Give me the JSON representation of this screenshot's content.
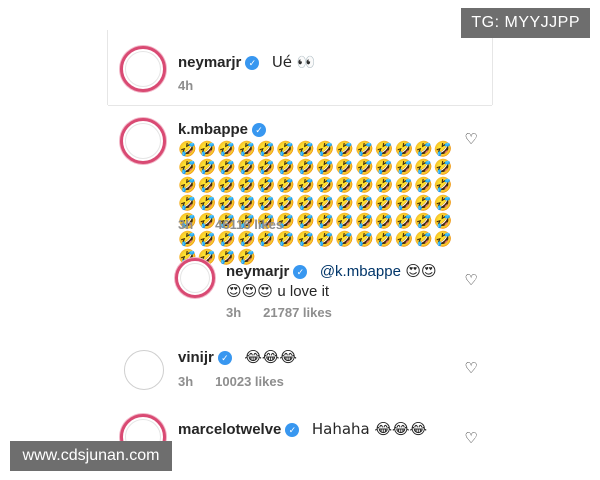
{
  "badge": {
    "text": "TG: MYYJJPP"
  },
  "watermark": {
    "text": "www.cdsjunan.com"
  },
  "verified_glyph": "✓",
  "heart_glyph": "♡",
  "comments": [
    {
      "user": "neymarjr",
      "text": "Ué 👀",
      "time": "4h"
    },
    {
      "user": "k.mbappe",
      "text": "🤣🤣🤣🤣🤣🤣🤣🤣🤣🤣🤣🤣🤣🤣🤣🤣🤣🤣🤣🤣🤣🤣🤣🤣🤣🤣🤣🤣🤣🤣🤣🤣🤣🤣🤣🤣🤣🤣🤣🤣🤣🤣🤣🤣🤣🤣🤣🤣🤣🤣🤣🤣🤣🤣🤣🤣🤣🤣🤣🤣🤣🤣🤣🤣🤣🤣🤣🤣🤣🤣🤣🤣🤣🤣🤣🤣🤣🤣🤣🤣🤣🤣🤣🤣🤣🤣🤣🤣",
      "time": "3h",
      "likes": "46116 likes"
    },
    {
      "user": "neymarjr",
      "mention": "@k.mbappe",
      "emoji1": "😍😍",
      "emoji2": "😍😍😍",
      "text": "u love it",
      "time": "3h",
      "likes": "21787 likes"
    },
    {
      "user": "vinijr",
      "text": "😂😂😂",
      "time": "3h",
      "likes": "10023 likes"
    },
    {
      "user": "marcelotwelve",
      "text": "Hahaha 😂😂😂"
    }
  ]
}
